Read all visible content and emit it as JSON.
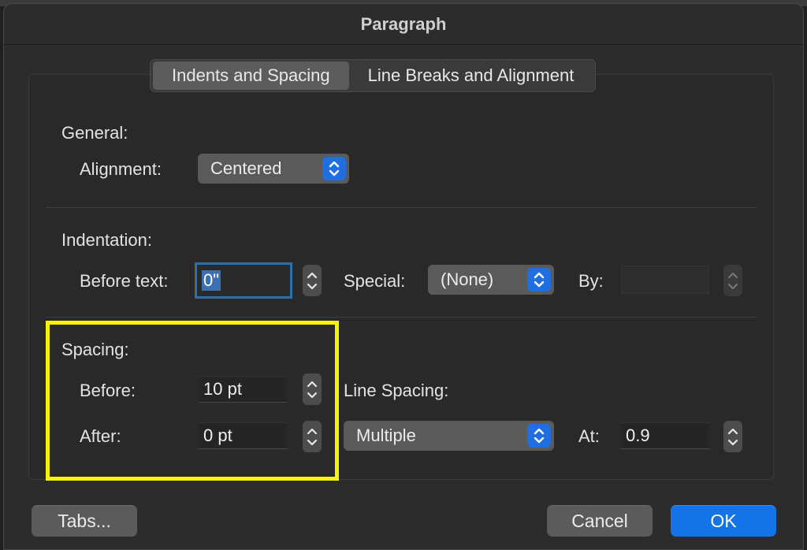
{
  "window": {
    "title": "Paragraph"
  },
  "tabs": [
    {
      "label": "Indents and Spacing",
      "active": true
    },
    {
      "label": "Line Breaks and Alignment",
      "active": false
    }
  ],
  "general": {
    "heading": "General:",
    "alignment_label": "Alignment:",
    "alignment_value": "Centered"
  },
  "indentation": {
    "heading": "Indentation:",
    "before_text_label": "Before text:",
    "before_text_value": "0\"",
    "special_label": "Special:",
    "special_value": "(None)",
    "by_label": "By:",
    "by_value": ""
  },
  "spacing": {
    "heading": "Spacing:",
    "before_label": "Before:",
    "before_value": "10 pt",
    "after_label": "After:",
    "after_value": "0 pt",
    "line_spacing_label": "Line Spacing:",
    "line_spacing_value": "Multiple",
    "at_label": "At:",
    "at_value": "0.9"
  },
  "buttons": {
    "tabs": "Tabs...",
    "cancel": "Cancel",
    "ok": "OK"
  },
  "colors": {
    "accent": "#1473e6",
    "highlight": "#f7f20a",
    "focus_ring": "#2f6fa8"
  },
  "icons": {
    "popup": "chevron-updown-icon",
    "stepper": "stepper-arrows-icon"
  }
}
